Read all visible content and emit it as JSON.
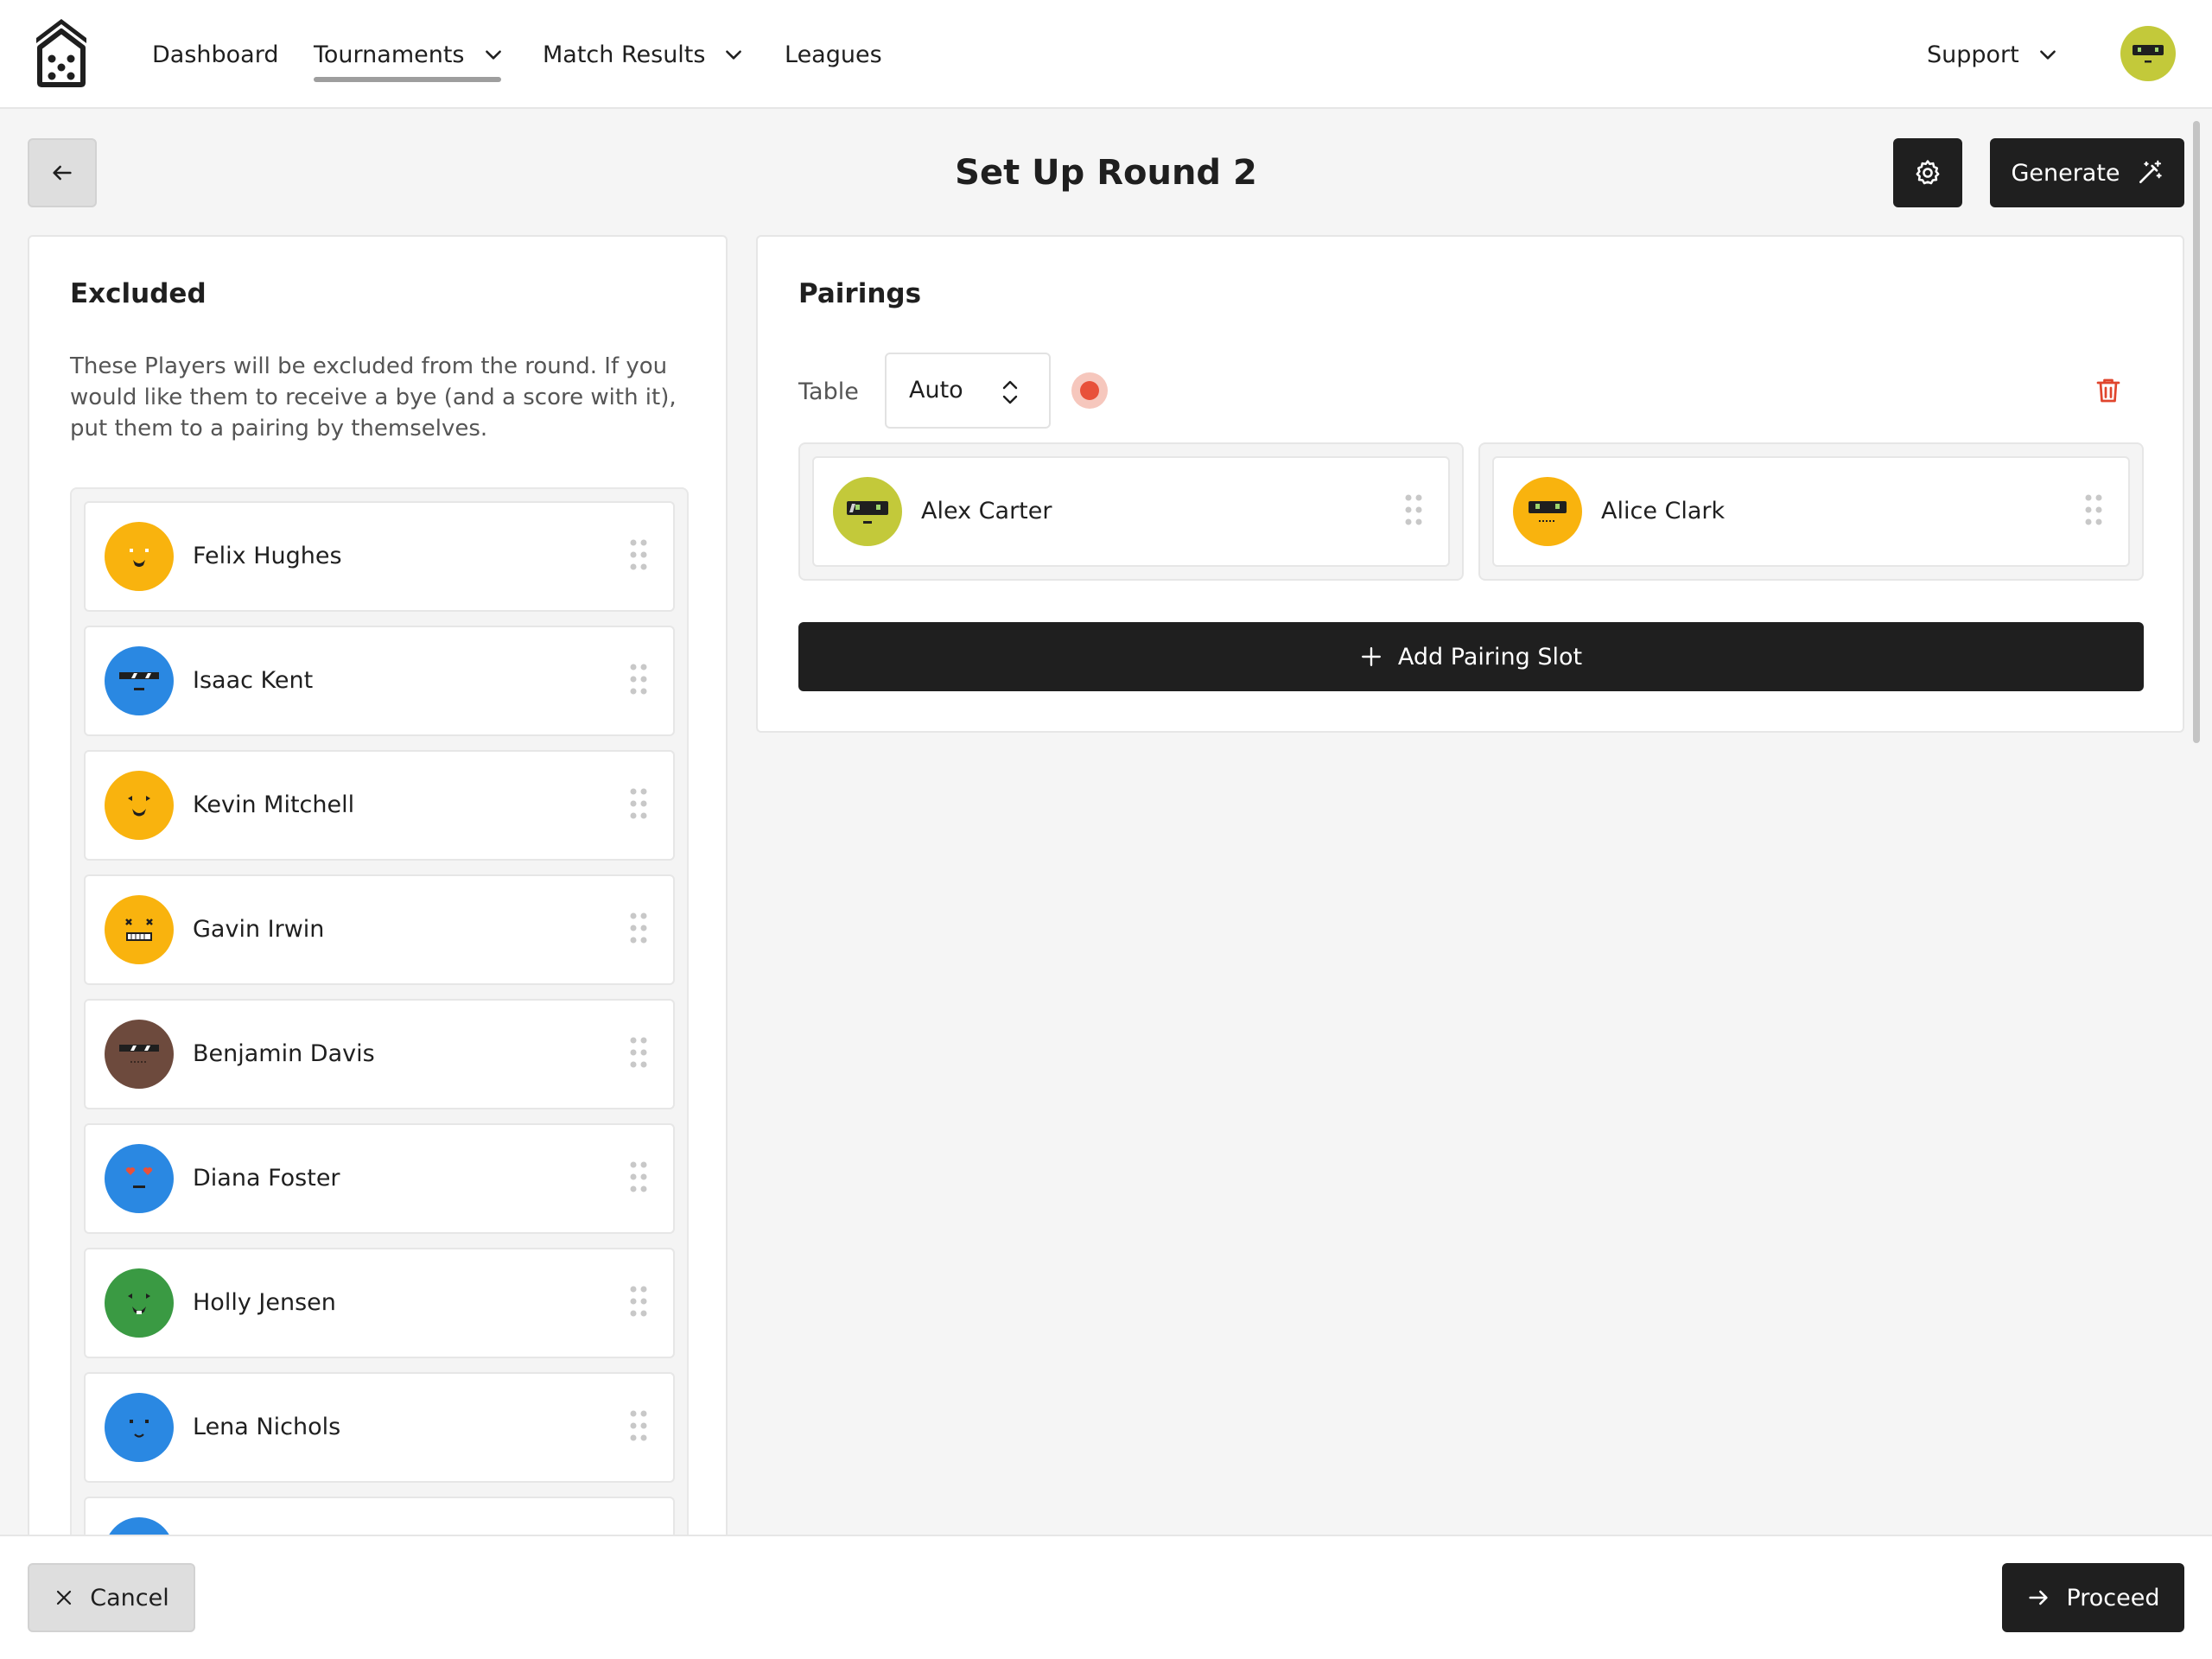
{
  "nav": {
    "logo_icon": "dice-house-logo",
    "items": [
      {
        "label": "Dashboard"
      },
      {
        "label": "Tournaments",
        "has_dropdown": true,
        "active": true
      },
      {
        "label": "Match Results",
        "has_dropdown": true
      },
      {
        "label": "Leagues"
      }
    ],
    "support_label": "Support",
    "user_avatar": {
      "color": "#c3c93a",
      "icon": "user-avatar-icon"
    }
  },
  "header": {
    "title": "Set Up Round 2",
    "back_icon": "arrow-left-icon",
    "settings_icon": "gear-icon",
    "generate_label": "Generate",
    "generate_icon": "magic-wand-icon"
  },
  "excluded": {
    "title": "Excluded",
    "description": "These Players will be excluded from the round. If you would like them to receive a bye (and a score with it), put them to a pairing by themselves.",
    "players": [
      {
        "name": "Felix Hughes",
        "color": "#f9b30e",
        "face": "smile"
      },
      {
        "name": "Isaac Kent",
        "color": "#2a88e2",
        "face": "shades"
      },
      {
        "name": "Kevin Mitchell",
        "color": "#f9b30e",
        "face": "squint"
      },
      {
        "name": "Gavin Irwin",
        "color": "#f9b30e",
        "face": "dead"
      },
      {
        "name": "Benjamin Davis",
        "color": "#6d4a3d",
        "face": "shades"
      },
      {
        "name": "Diana Foster",
        "color": "#2a88e2",
        "face": "hearts"
      },
      {
        "name": "Holly Jensen",
        "color": "#3a9a43",
        "face": "squint"
      },
      {
        "name": "Lena Nichols",
        "color": "#2a88e2",
        "face": "happy"
      },
      {
        "name": "",
        "color": "#2a88e2",
        "face": "happy"
      }
    ]
  },
  "pairings": {
    "title": "Pairings",
    "table_label": "Table",
    "table_value": "Auto",
    "status_color": "#e8513a",
    "slots": [
      {
        "name": "Alex Carter",
        "color": "#c3c93a",
        "face": "visor"
      },
      {
        "name": "Alice Clark",
        "color": "#f9b30e",
        "face": "visor"
      }
    ],
    "add_label": "Add Pairing Slot"
  },
  "footer": {
    "cancel_label": "Cancel",
    "proceed_label": "Proceed"
  }
}
